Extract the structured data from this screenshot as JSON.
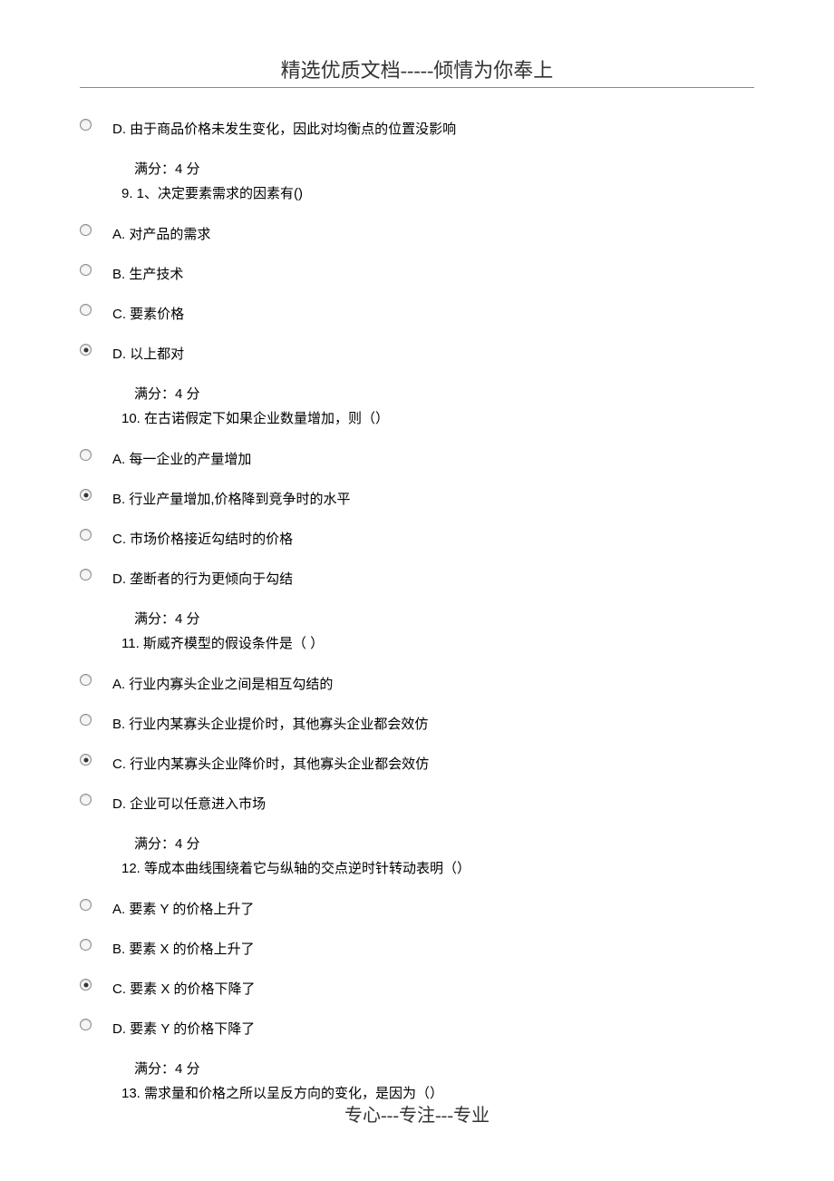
{
  "header": {
    "title": "精选优质文档-----倾情为你奉上"
  },
  "footer": {
    "text": "专心---专注---专业"
  },
  "q8": {
    "optD": "D.  由于商品价格未发生变化，因此对均衡点的位置没影响",
    "score": "满分：4 分"
  },
  "q9": {
    "prompt": "9. 1、决定要素需求的因素有()",
    "optA": "A.  对产品的需求",
    "optB": "B.  生产技术",
    "optC": "C.  要素价格",
    "optD": "D.  以上都对",
    "score": "满分：4 分"
  },
  "q10": {
    "prompt": "10.  在古诺假定下如果企业数量增加，则（）",
    "optA": "A.  每一企业的产量增加",
    "optB": "B.  行业产量增加,价格降到竞争时的水平",
    "optC": "C.  市场价格接近勾结时的价格",
    "optD": "D.  垄断者的行为更倾向于勾结",
    "score": "满分：4 分"
  },
  "q11": {
    "prompt": "11.  斯威齐模型的假设条件是（  ）",
    "optA": "A.  行业内寡头企业之间是相互勾结的",
    "optB": "B.  行业内某寡头企业提价时，其他寡头企业都会效仿",
    "optC": "C.  行业内某寡头企业降价时，其他寡头企业都会效仿",
    "optD": "D.  企业可以任意进入市场",
    "score": "满分：4 分"
  },
  "q12": {
    "prompt": "12.  等成本曲线围绕着它与纵轴的交点逆时针转动表明（）",
    "optA": "A.  要素 Y 的价格上升了",
    "optB": "B.  要素 X 的价格上升了",
    "optC": "C.  要素 X 的价格下降了",
    "optD": "D.  要素 Y 的价格下降了",
    "score": "满分：4 分"
  },
  "q13": {
    "prompt": "13.  需求量和价格之所以呈反方向的变化，是因为（）"
  }
}
